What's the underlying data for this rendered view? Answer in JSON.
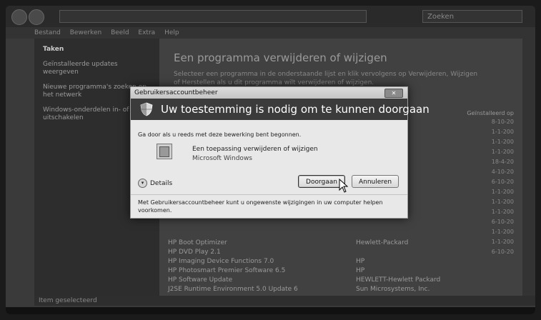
{
  "window": {
    "search_placeholder": "Zoeken",
    "menu": [
      "Bestand",
      "Bewerken",
      "Beeld",
      "Extra",
      "Help"
    ],
    "status": "Item geselecteerd"
  },
  "left_pane": {
    "items": [
      "Taken",
      "Geïnstalleerde updates weergeven",
      "Nieuwe programma's zoeken op het netwerk",
      "Windows-onderdelen in- of uitschakelen"
    ]
  },
  "main": {
    "title": "Een programma verwijderen of wijzigen",
    "description": "Selecteer een programma in de onderstaande lijst en klik vervolgens op Verwijderen, Wijzigen of Herstellen als u dit programma wilt verwijderen of wijzigen.",
    "column_date": "Geïnstalleerd op",
    "programs": [
      {
        "name": "HP Boot Optimizer",
        "publisher": "Hewlett-Packard"
      },
      {
        "name": "HP DVD Play 2.1",
        "publisher": ""
      },
      {
        "name": "HP Imaging Device Functions 7.0",
        "publisher": "HP"
      },
      {
        "name": "HP Photosmart Premier Software 6.5",
        "publisher": "HP"
      },
      {
        "name": "HP Software Update",
        "publisher": "HEWLETT-Hewlett Packard"
      },
      {
        "name": "J2SE Runtime Environment 5.0 Update 6",
        "publisher": "Sun Microsystems, Inc."
      }
    ],
    "dates": [
      "8-10-20",
      "1-1-200",
      "1-1-200",
      "1-1-200",
      "18-4-20",
      "4-10-20",
      "6-10-20",
      "1-1-200",
      "1-1-200",
      "1-1-200",
      "6-10-20",
      "1-1-200",
      "1-1-200",
      "6-10-20"
    ]
  },
  "dialog": {
    "title": "Gebruikersaccountbeheer",
    "close_label": "✕",
    "banner": "Uw toestemming is nodig om te kunnen doorgaan",
    "intro": "Ga door als u reeds met deze bewerking bent begonnen.",
    "program_name": "Een toepassing verwijderen of wijzigen",
    "program_publisher": "Microsoft Windows",
    "details_label": "Details",
    "continue_label": "Doorgaan",
    "cancel_label": "Annuleren",
    "footer": "Met Gebruikersaccountbeheer kunt u ongewenste wijzigingen in uw computer helpen voorkomen."
  }
}
